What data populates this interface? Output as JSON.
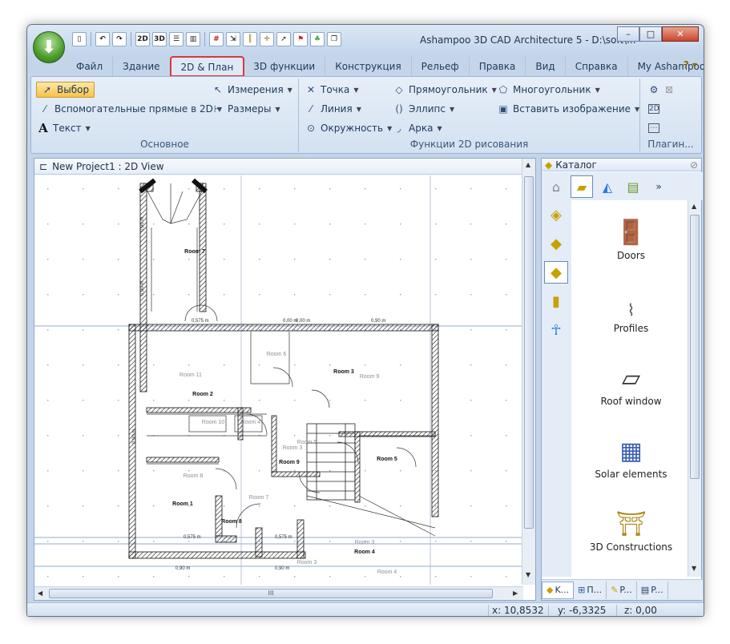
{
  "window": {
    "title": "Ashampoo 3D CAD Architecture 5 - D:\\soft\\...",
    "minimize": "–",
    "maximize": "□",
    "close": "✕"
  },
  "quick_access": [
    "new",
    "undo",
    "redo",
    "2D",
    "3D",
    "split-h",
    "split-v",
    "grid",
    "cursor",
    "snap",
    "pointer",
    "flag",
    "tree",
    "copy"
  ],
  "tabs": [
    {
      "label": "Файл"
    },
    {
      "label": "Здание"
    },
    {
      "label": "2D & План"
    },
    {
      "label": "3D функции"
    },
    {
      "label": "Конструкция"
    },
    {
      "label": "Рельеф"
    },
    {
      "label": "Правка"
    },
    {
      "label": "Вид"
    },
    {
      "label": "Справка"
    },
    {
      "label": "My Ashampoo"
    }
  ],
  "active_tab": "2D & План",
  "ribbon": {
    "basic": {
      "select": "Выбор",
      "helper_lines": "Вспомогательные прямые в 2D",
      "text": "Текст",
      "measurements": "Измерения",
      "dimensions": "Размеры",
      "label": "Основное"
    },
    "draw2d": {
      "point": "Точка",
      "line": "Линия",
      "circle": "Окружность",
      "rectangle": "Прямоугольник",
      "ellipse": "Эллипс",
      "arc": "Арка",
      "polygon": "Многоугольник",
      "insert_image": "Вставить изображение",
      "label": "Функции 2D рисования"
    },
    "plugins": {
      "label": "Плагин..."
    }
  },
  "view": {
    "title": "New Project1 : 2D View",
    "scroll_label": "III"
  },
  "plan": {
    "rooms": [
      {
        "label": "Room 7",
        "bold": true
      },
      {
        "label": "Room 6",
        "bold": false
      },
      {
        "label": "Room 3",
        "bold": true
      },
      {
        "label": "Room 9",
        "bold": false
      },
      {
        "label": "Room 11",
        "bold": false
      },
      {
        "label": "Room 2",
        "bold": true
      },
      {
        "label": "Room 10",
        "bold": false
      },
      {
        "label": "Room 4",
        "bold": false
      },
      {
        "label": "Room 5",
        "bold": false
      },
      {
        "label": "Room 3",
        "bold": false
      },
      {
        "label": "Room 9",
        "bold": true
      },
      {
        "label": "Room 5",
        "bold": true
      },
      {
        "label": "Room 8",
        "bold": false
      },
      {
        "label": "Room 1",
        "bold": true
      },
      {
        "label": "Room 7",
        "bold": false
      },
      {
        "label": "Room 8",
        "bold": true
      },
      {
        "label": "Room 3",
        "bold": false
      },
      {
        "label": "Room 4",
        "bold": true
      },
      {
        "label": "Room 3",
        "bold": false
      },
      {
        "label": "Room 4",
        "bold": false
      }
    ],
    "dims": [
      "0,90 m",
      "0,00 m",
      "0,00 m",
      "0,90 m",
      "0,575 m",
      "0,90 m",
      "0,90 m",
      "0,90 m",
      "0,575 m",
      "0,575 m",
      "0,90 m"
    ]
  },
  "catalog": {
    "title": "Каталог",
    "more": "»",
    "items": [
      {
        "label": "Doors"
      },
      {
        "label": "Profiles"
      },
      {
        "label": "Roof window"
      },
      {
        "label": "Solar elements"
      },
      {
        "label": "3D Constructions"
      }
    ],
    "tabs": [
      "K...",
      "П...",
      "P...",
      "P..."
    ]
  },
  "status": {
    "x": "x: 10,8532",
    "y": "y: -6,3325",
    "z": "z: 0,00"
  }
}
